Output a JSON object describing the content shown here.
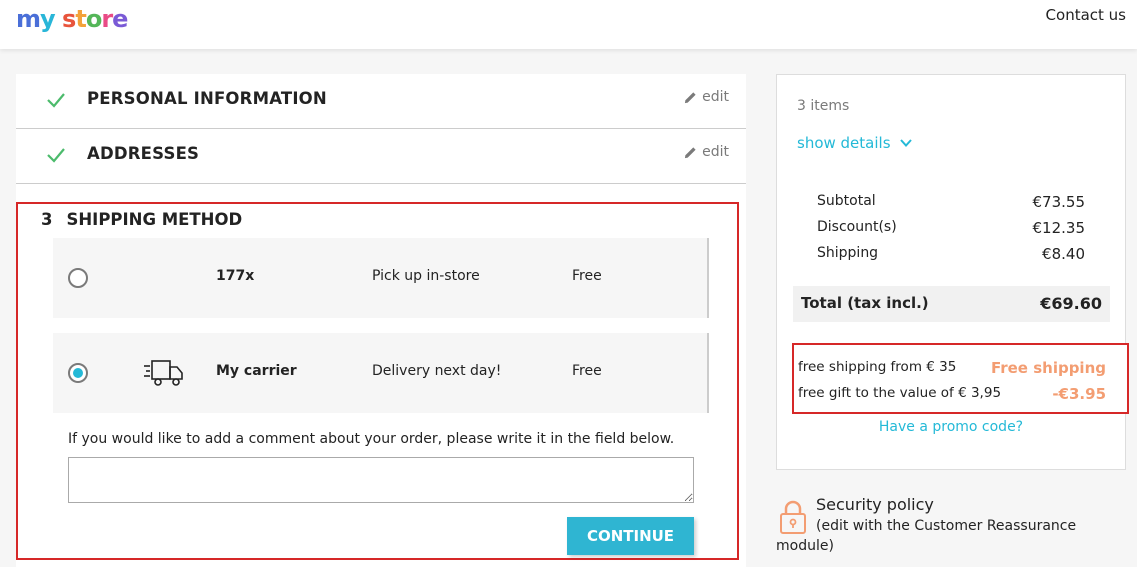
{
  "header": {
    "logo_text": "my store",
    "contact_label": "Contact us"
  },
  "steps": {
    "personal": {
      "title": "PERSONAL INFORMATION",
      "edit_label": "edit"
    },
    "addresses": {
      "title": "ADDRESSES",
      "edit_label": "edit"
    },
    "shipping": {
      "number": "3",
      "title": "SHIPPING METHOD",
      "carriers": [
        {
          "name": "177x",
          "delay": "Pick up in-store",
          "price": "Free",
          "selected": false
        },
        {
          "name": "My carrier",
          "delay": "Delivery next day!",
          "price": "Free",
          "selected": true,
          "icon": "truck-icon"
        }
      ],
      "comment_label": "If you would like to add a comment about your order, please write it in the field below.",
      "comment_value": "",
      "continue_label": "CONTINUE"
    }
  },
  "summary": {
    "items_count": "3 items",
    "show_details": "show details",
    "lines": [
      {
        "label": "Subtotal",
        "value": "€73.55"
      },
      {
        "label": "Discount(s)",
        "value": "€12.35"
      },
      {
        "label": "Shipping",
        "value": "€8.40"
      }
    ],
    "total_label": "Total (tax incl.)",
    "total_value": "€69.60",
    "promos": [
      {
        "label": "free shipping from € 35",
        "value": "Free shipping"
      },
      {
        "label": "free gift to the value of € 3,95",
        "value": "-€3.95"
      }
    ],
    "promo_link": "Have a promo code?"
  },
  "reassurance": {
    "title": "Security policy",
    "text": "(edit with the Customer Reassurance module)"
  },
  "colors": {
    "accent": "#24b9d7",
    "button": "#2fb5d2",
    "check": "#4cbb6c",
    "highlight_border": "#d62828",
    "promo": "#f39d72"
  }
}
